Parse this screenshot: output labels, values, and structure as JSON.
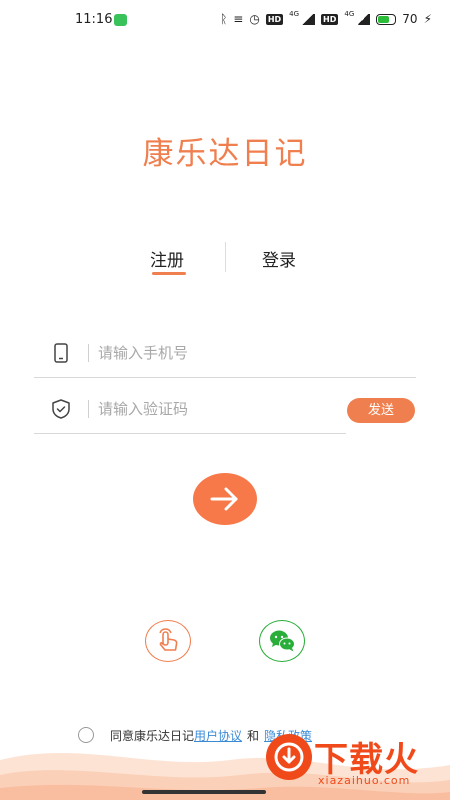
{
  "status_bar": {
    "time": "11:16",
    "network_left": "HD",
    "network_right": "HD",
    "gen_left": "4G",
    "gen_right": "4G",
    "battery": "70"
  },
  "app": {
    "title": "康乐达日记",
    "brand_color": "#f07f4f"
  },
  "tabs": [
    {
      "label": "注册",
      "active": true
    },
    {
      "label": "登录",
      "active": false
    }
  ],
  "form": {
    "phone": {
      "value": "",
      "placeholder": "请输入手机号",
      "icon": "phone-icon"
    },
    "code": {
      "value": "",
      "placeholder": "请输入验证码",
      "icon": "shield-check-icon"
    },
    "send_label": "发送",
    "submit_icon": "arrow-right-icon"
  },
  "alt_login": [
    {
      "icon": "fingerprint-touch-icon",
      "color": "#f07f4f"
    },
    {
      "icon": "wechat-icon",
      "color": "#2aae3a"
    }
  ],
  "agreement": {
    "prefix": "同意康乐达日记",
    "user_agreement": "用户协议",
    "and": "和",
    "privacy_policy": "隐私政策",
    "link_color": "#3b8ad6"
  },
  "watermark": {
    "text": "下载火",
    "subtext": "xiazaihuo.com"
  }
}
